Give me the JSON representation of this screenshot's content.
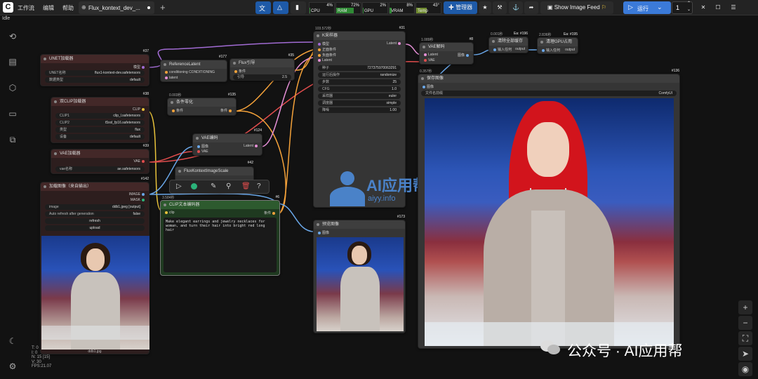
{
  "topbar": {
    "menu": [
      "工作流",
      "编辑",
      "帮助"
    ],
    "tab_title": "Flux_kontext_dev_...",
    "monitors": [
      {
        "label": "CPU",
        "pct": "4%",
        "color": "#2f8a35",
        "fill": 0.04
      },
      {
        "label": "RAM",
        "pct": "72%",
        "color": "#2f8a35",
        "fill": 0.72
      },
      {
        "label": "GPU",
        "pct": "2%",
        "color": "#2f8a35",
        "fill": 0.02
      },
      {
        "label": "VRAM",
        "pct": "8%",
        "color": "#2f8a35",
        "fill": 0.08
      },
      {
        "label": "Temp",
        "pct": "43°",
        "color": "#6f8a2f",
        "fill": 0.43
      }
    ],
    "manager_label": "管理器",
    "feed_label": "Show Image Feed",
    "run_label": "运行",
    "queue_count": "1"
  },
  "status": "Idle",
  "stats": [
    "T: 0",
    "I: 0",
    "N: 15 [15]",
    "V: 30",
    "FPS:21.07"
  ],
  "watermark": {
    "brand": "AI应用帮",
    "url": "aiyy.info",
    "wechat": "公众号 · AI应用帮"
  },
  "nodes": {
    "unet": {
      "title": "UNET加载器",
      "badge": "#37",
      "w1k": "UNET名称",
      "w1v": "flux1-kontext-dev.safetensors",
      "w2k": "数据类型",
      "w2v": "default",
      "out": "模型"
    },
    "dclip": {
      "title": "双CLIP加载器",
      "badge": "#38",
      "out": "CLIP",
      "rows": [
        [
          "CLIP1",
          "clip_l.safetensors"
        ],
        [
          "CLIP2",
          "t5xxl_fp16.safetensors"
        ],
        [
          "类型",
          "flux"
        ],
        [
          "设备",
          "default"
        ]
      ]
    },
    "vaeload": {
      "title": "VAE加载器",
      "badge": "#39",
      "out": "VAE",
      "w1k": "vae名称",
      "w1v": "ae.safetensors"
    },
    "loadimg": {
      "title": "加载图像（来自输出）",
      "badge": "#142",
      "out1": "IMAGE",
      "out2": "MASK",
      "w1k": "image",
      "w1v": "ddb1.jpeg [output]",
      "w2k": "Auto refresh after generation",
      "w2v": "false",
      "b1": "refresh",
      "b2": "upload",
      "caption": "ddb1.jpg"
    },
    "reflatent": {
      "title": "ReferenceLatent",
      "badge": "#177",
      "in1": "conditioning CONDITIONING",
      "in2": "latent"
    },
    "guidance": {
      "title": "Flux引导",
      "badge": "#35",
      "in1": "条件",
      "wk": "引导",
      "wv": "2.5"
    },
    "zerocond": {
      "title": "条件零化",
      "badge": "#135",
      "in1": "条件",
      "out": "条件",
      "sub": "0.003秒"
    },
    "vaeenc": {
      "title": "VAE编码",
      "badge": "#124",
      "in1": "图像",
      "in2": "VAE",
      "out": "Latent"
    },
    "scale": {
      "title": "FluxKontextImageScale",
      "badge": "#42",
      "out": "图像"
    },
    "cliptext": {
      "title": "CLIP文本编码器",
      "badge": "#6",
      "sub": "3.584秒",
      "in1": "clip",
      "out": "条件",
      "text": "Make elegant earrings and jewelry necklaces for woman, and turn their hair into bright red long hair"
    },
    "ksampler": {
      "title": "K采样器",
      "badge": "#31",
      "sub": "103.572秒",
      "in": [
        "模型",
        "正面条件",
        "负面条件",
        "Latent"
      ],
      "out": "Latent",
      "rows": [
        [
          "种子",
          "727375970063291"
        ],
        [
          "运行后操作",
          "randomize"
        ],
        [
          "步数",
          "25"
        ],
        [
          "CFG",
          "1.0"
        ],
        [
          "采样器",
          "euler"
        ],
        [
          "调度器",
          "simple"
        ],
        [
          "降噪",
          "1.00"
        ]
      ]
    },
    "vaedec": {
      "title": "VAE解码",
      "badge": "#8",
      "sub": "1.089秒",
      "in1": "Latent",
      "in2": "VAE",
      "out": "图像"
    },
    "clearcache": {
      "title": "清除全部缓存",
      "badge": "Ea: #196",
      "sub": "0.001秒",
      "in1": "输入任何",
      "out": "output"
    },
    "cleargpu": {
      "title": "清理GPU占用",
      "badge": "Ea: #195",
      "sub": "2.836秒",
      "in1": "输入任何",
      "out": "output"
    },
    "save": {
      "title": "保存图像",
      "badge": "#136",
      "sub": "0.357秒",
      "in1": "图像",
      "wk": "文件名前缀",
      "wv": "ComfyUI"
    },
    "preview": {
      "title": "预览图像",
      "badge": "#173",
      "in1": "图像"
    }
  },
  "colors": {
    "accent": "#3b7ad8",
    "canvas": "#121212",
    "node": "#353535",
    "red_node": "#2d1e1e",
    "green_node": "#1f3a20"
  }
}
